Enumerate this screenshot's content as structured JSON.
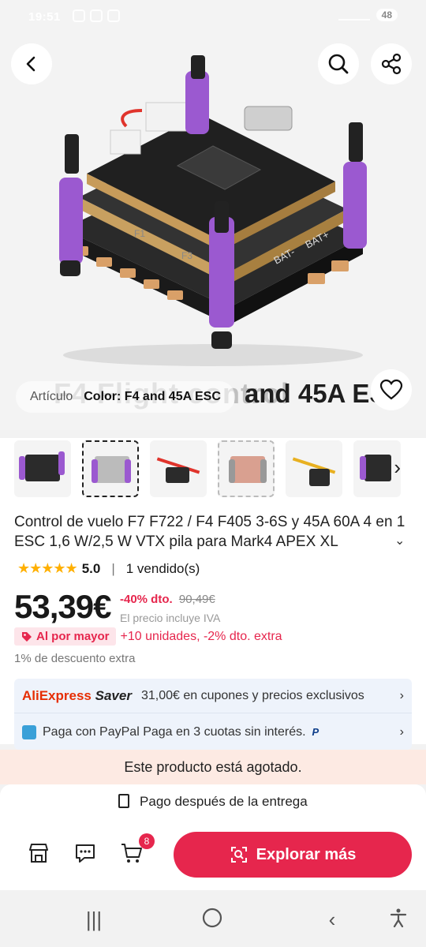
{
  "statusbar": {
    "time": "19:51",
    "battery": "48"
  },
  "hero": {
    "ghost_text_faded": "F4 Flight control",
    "ghost_text_strong": "and 45A ESC",
    "attribute_label": "Artículo",
    "attribute_value": "Color: F4 and 45A ESC",
    "board_labels": {
      "bat_minus": "BAT-",
      "bat_plus": "BAT+",
      "f1": "F1",
      "f3": "F3"
    }
  },
  "thumbnails": [
    {
      "id": "thumb-1",
      "state": "normal"
    },
    {
      "id": "thumb-2",
      "state": "selected"
    },
    {
      "id": "thumb-3",
      "state": "normal"
    },
    {
      "id": "thumb-4",
      "state": "dashed"
    },
    {
      "id": "thumb-5",
      "state": "normal"
    },
    {
      "id": "thumb-6",
      "state": "normal"
    }
  ],
  "product": {
    "title": "Control de vuelo F7 F722 / F4 F405 3-6S y 45A 60A 4 en 1 ESC 1,6 W/2,5 W VTX pila para Mark4 APEX XL",
    "rating_stars": "★★★★★",
    "rating_score": "5.0",
    "rating_sep": "|",
    "sold": "1 vendido(s)",
    "price": "53,39€",
    "discount": "-40% dto.",
    "old_price": "90,49€",
    "tax_note": "El precio incluye IVA",
    "wholesale_badge": "Al por mayor",
    "wholesale_text": "+10 unidades, -2% dto. extra",
    "extra_discount": "1% de descuento extra"
  },
  "promo": {
    "saver_brand_a": "AliExpress",
    "saver_brand_b": "Saver",
    "saver_text": "31,00€ en cupones y precios exclusivos",
    "paypal_text": "Paga con PayPal Paga en 3 cuotas sin interés.",
    "paypal_badge": "P"
  },
  "soldout_text": "Este producto está agotado.",
  "bottom": {
    "cod_text": "Pago después de la entrega",
    "cart_count": "8",
    "explore_label": "Explorar más"
  },
  "colors": {
    "accent": "#e6264d",
    "rating": "#ffb000",
    "promo_bg": "#eef3fb",
    "soldout_bg": "#fdeae3",
    "board_purple": "#9b59d0"
  }
}
